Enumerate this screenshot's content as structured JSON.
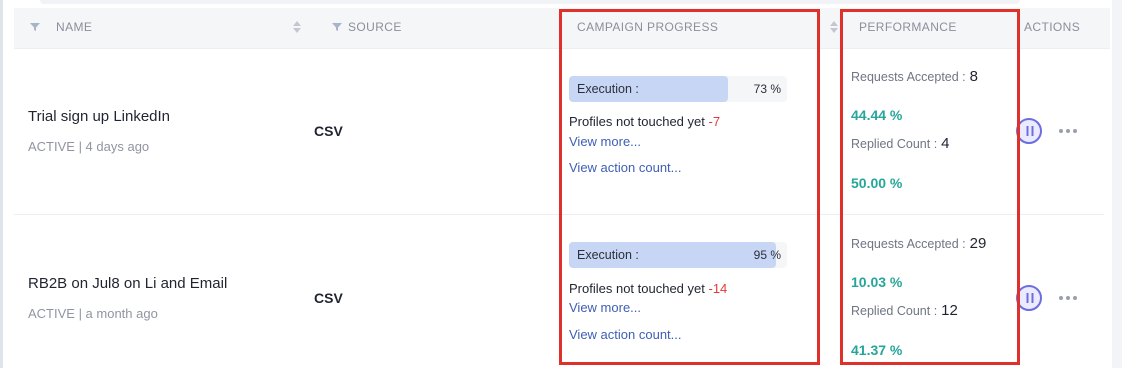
{
  "header": {
    "name": "NAME",
    "source": "SOURCE",
    "campaign_progress": "CAMPAIGN PROGRESS",
    "performance": "PERFORMANCE",
    "actions": "ACTIONS"
  },
  "rows": [
    {
      "name": "Trial sign up LinkedIn",
      "meta": "ACTIVE | 4 days ago",
      "source": "CSV",
      "execution_label": "Execution :",
      "execution_pct_text": "73 %",
      "execution_fraction": 0.73,
      "not_touched_label": "Profiles not touched yet",
      "not_touched_value": "-7",
      "view_more": "View more...",
      "view_action_count": "View action count...",
      "requests_accepted_label": "Requests Accepted :",
      "requests_accepted_value": "8",
      "accepted_pct": "44.44 %",
      "replied_label": "Replied Count :",
      "replied_value": "4",
      "replied_pct": "50.00 %"
    },
    {
      "name": "RB2B on Jul8 on Li and Email",
      "meta": "ACTIVE | a month ago",
      "source": "CSV",
      "execution_label": "Execution :",
      "execution_pct_text": "95 %",
      "execution_fraction": 0.95,
      "not_touched_label": "Profiles not touched yet",
      "not_touched_value": "-14",
      "view_more": "View more...",
      "view_action_count": "View action count...",
      "requests_accepted_label": "Requests Accepted :",
      "requests_accepted_value": "29",
      "accepted_pct": "10.03 %",
      "replied_label": "Replied Count :",
      "replied_value": "12",
      "replied_pct": "41.37 %"
    }
  ],
  "colors": {
    "highlight": "#e0302b",
    "positive": "#26a69a",
    "negative": "#e53935",
    "link": "#3f5fb5",
    "progress": "#c8d6f5",
    "pause": "#6b6ee0"
  },
  "icons": {
    "filter": "filter-icon",
    "sort": "sort-icon",
    "pause": "pause-icon",
    "more": "more-horizontal-icon"
  }
}
